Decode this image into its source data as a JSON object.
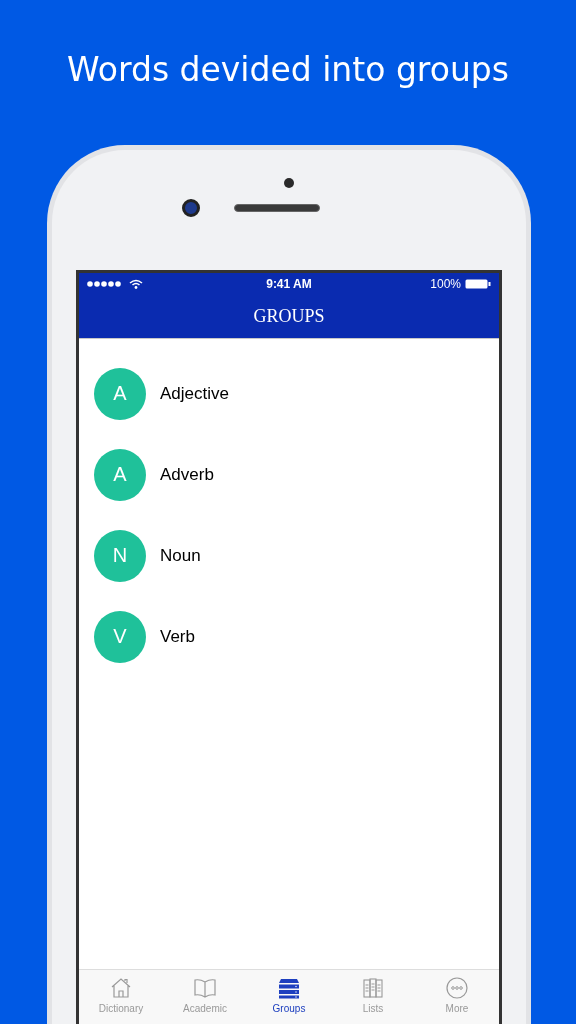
{
  "headline": "Words devided into groups",
  "status_bar": {
    "time": "9:41 AM",
    "battery": "100%"
  },
  "nav": {
    "title": "GROUPS"
  },
  "groups": [
    {
      "letter": "A",
      "name": "Adjective"
    },
    {
      "letter": "A",
      "name": "Adverb"
    },
    {
      "letter": "N",
      "name": "Noun"
    },
    {
      "letter": "V",
      "name": "Verb"
    }
  ],
  "tabs": [
    {
      "label": "Dictionary",
      "selected": false
    },
    {
      "label": "Academic",
      "selected": false
    },
    {
      "label": "Groups",
      "selected": true
    },
    {
      "label": "Lists",
      "selected": false
    },
    {
      "label": "More",
      "selected": false
    }
  ]
}
